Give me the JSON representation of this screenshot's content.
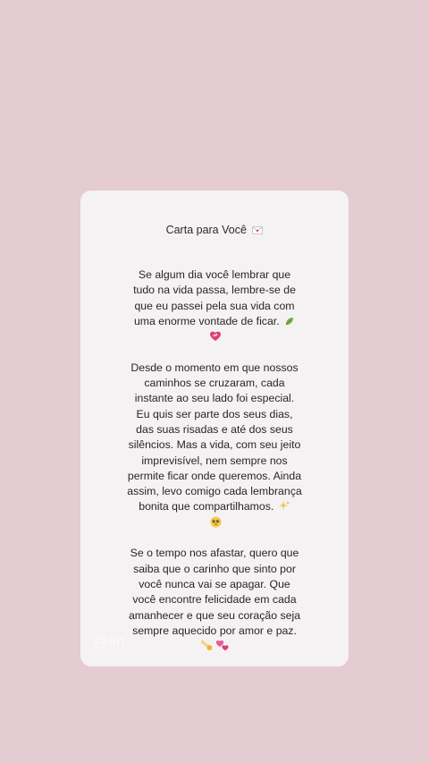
{
  "letter": {
    "title": "Carta para Você",
    "title_icon": "love-letter-icon",
    "paragraphs": [
      {
        "text": "Se algum dia você lembrar que tudo na vida passa, lembre-se de que eu passei pela sua vida com uma enorme vontade de ficar.",
        "emojis": [
          "leaf-icon",
          "mending-heart-icon"
        ]
      },
      {
        "text": "Desde o momento em que nossos caminhos se cruzaram, cada instante ao seu lado foi especial. Eu quis ser parte dos seus dias, das suas risadas e até dos seus silêncios. Mas a vida, com seu jeito imprevisível, nem sempre nos permite ficar onde queremos. Ainda assim, levo comigo cada lembrança bonita que compartilhamos.",
        "emojis": [
          "sparkles-icon",
          "pleading-face-icon"
        ]
      },
      {
        "text": "Se o tempo nos afastar, quero que saiba que o carinho que sinto por você nunca vai se apagar. Que você encontre felicidade em cada amanhecer e que seu coração seja sempre aquecido por amor e paz.",
        "emojis": [
          "comet-icon",
          "two-hearts-icon"
        ]
      }
    ]
  },
  "watermark": {
    "text": "@lin"
  },
  "colors": {
    "background": "#e5cbd2",
    "card": "#f5f2f4",
    "text": "#262626"
  }
}
